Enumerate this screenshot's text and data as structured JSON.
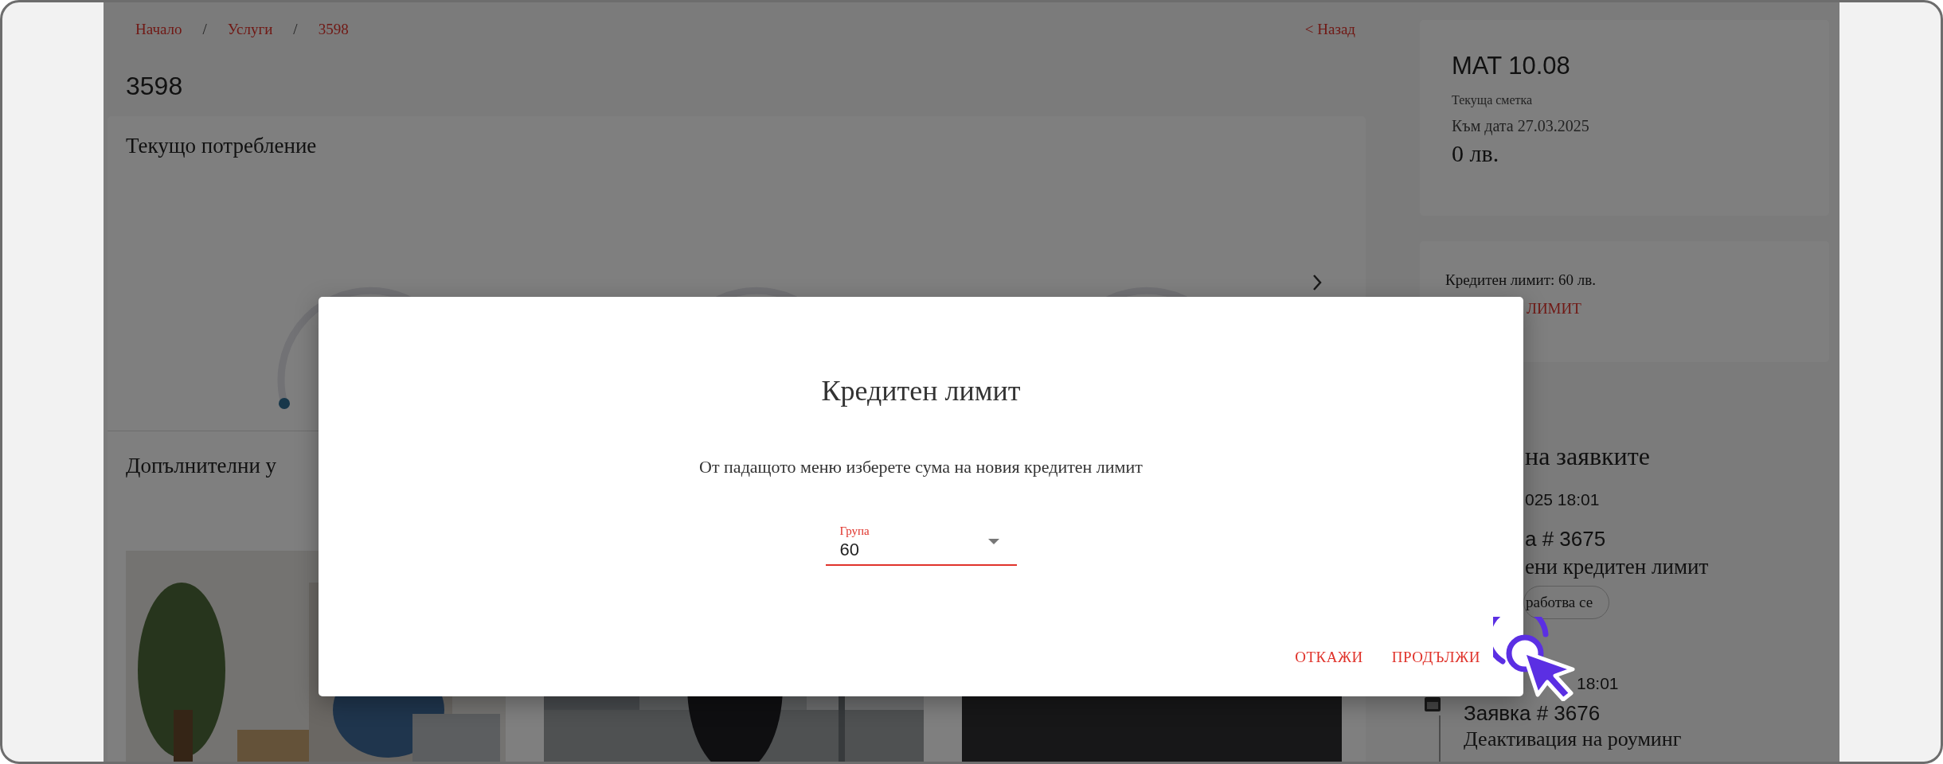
{
  "breadcrumb": [
    {
      "kind": "link",
      "label": "Начало"
    },
    {
      "kind": "separator",
      "label": "/"
    },
    {
      "kind": "link",
      "label": "Услуги"
    },
    {
      "kind": "separator",
      "label": "/"
    },
    {
      "kind": "link",
      "label": "3598"
    }
  ],
  "back_link": "< Назад",
  "page_title": "3598",
  "usage_card": {
    "title": "Текущо потребление"
  },
  "extras": {
    "title": "Допълнителни у"
  },
  "account_card": {
    "plan": "MAT 10.08",
    "label": "Текуща сметка",
    "date": "Към дата 27.03.2025",
    "amount": "0 лв."
  },
  "credit_card": {
    "text": "Кредитен лимит: 60 лв.",
    "link": "ЛИМИТ"
  },
  "history": {
    "title": "на заявките",
    "items": [
      {
        "date": "025 18:01",
        "request": "а # 3675",
        "description": "ени кредитен лимит",
        "status": "работва се"
      },
      {
        "date": "18:01",
        "request": "Заявка # 3676",
        "description": "Деактивация на роуминг"
      }
    ]
  },
  "dialog": {
    "title": "Кредитен лимит",
    "message": "От падащото меню изберете сума на новия кредитен лимит",
    "select": {
      "label": "Група",
      "value": "60"
    },
    "buttons": [
      "ОТКАЖИ",
      "ПРОДЪЛЖИ"
    ]
  }
}
